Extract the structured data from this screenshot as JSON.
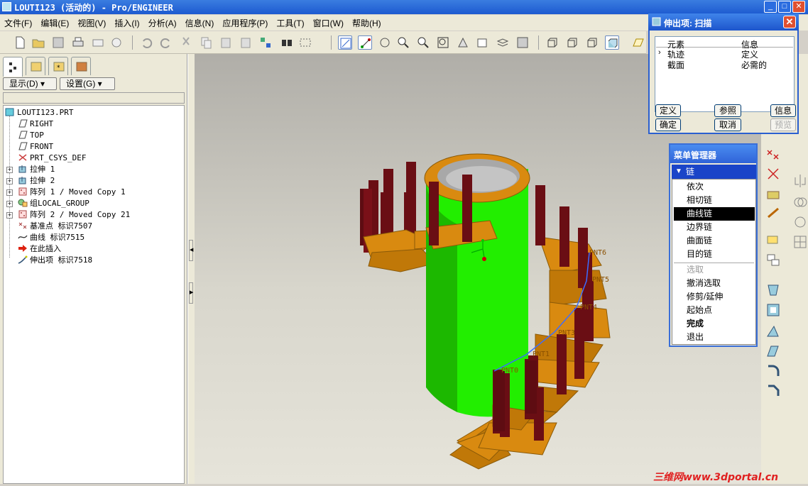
{
  "window": {
    "title": "LOUTI123 (活动的) - Pro/ENGINEER"
  },
  "menus": [
    "文件(F)",
    "编辑(E)",
    "视图(V)",
    "插入(I)",
    "分析(A)",
    "信息(N)",
    "应用程序(P)",
    "工具(T)",
    "窗口(W)",
    "帮助(H)"
  ],
  "panel": {
    "show_label": "显示(D)",
    "settings_label": "设置(G)"
  },
  "tree": {
    "root": "LOUTI123.PRT",
    "items": [
      "RIGHT",
      "TOP",
      "FRONT",
      "PRT_CSYS_DEF",
      "拉伸 1",
      "拉伸 2",
      "阵列 1 / Moved Copy 1",
      "组LOCAL_GROUP",
      "阵列 2 / Moved Copy 21",
      "基准点 标识7507",
      "曲线 标识7515",
      "在此插入",
      "伸出项 标识7518"
    ]
  },
  "points": [
    "PNT6",
    "PNT5",
    "PNT4",
    "PNT3",
    "PNT1",
    "PNT0"
  ],
  "dialog": {
    "title": "伸出项: 扫描",
    "col_element": "元素",
    "col_info": "信息",
    "rows": [
      {
        "element": "轨迹",
        "info": "定义"
      },
      {
        "element": "截面",
        "info": "必需的"
      }
    ],
    "buttons": {
      "define": "定义",
      "reference": "参照",
      "info": "信息",
      "ok": "确定",
      "cancel": "取消",
      "preview": "预览"
    }
  },
  "menu_manager": {
    "title": "菜单管理器",
    "header": "链",
    "items": [
      "依次",
      "相切链",
      "曲线链",
      "边界链",
      "曲面链",
      "目的链"
    ],
    "selected": "曲线链",
    "actions": [
      "选取",
      "撤消选取",
      "修剪/延伸",
      "起始点",
      "完成",
      "退出"
    ]
  },
  "watermark": "三维网www.3dportal.cn",
  "colors": {
    "titlebar": "#1d5ad0",
    "body": "#22ee00",
    "steps": "#d98a10",
    "posts": "#6a0e14"
  }
}
